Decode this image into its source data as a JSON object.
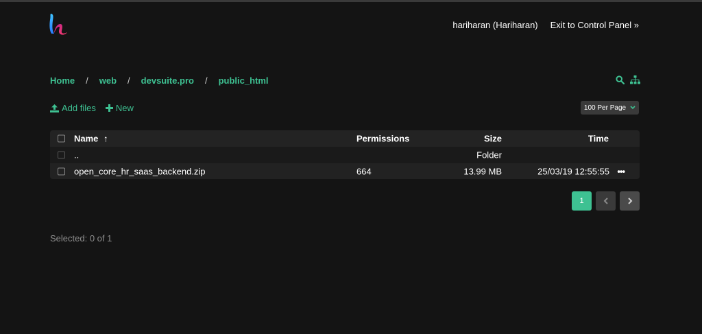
{
  "header": {
    "user_label": "hariharan (Hariharan)",
    "exit_label": "Exit to Control Panel »"
  },
  "breadcrumb": [
    "Home",
    "web",
    "devsuite.pro",
    "public_html"
  ],
  "breadcrumb_separator": "/",
  "toolbar": {
    "add_files_label": "Add files",
    "new_label": "New",
    "per_page_label": "100 Per Page",
    "icons": [
      "search-icon",
      "sitemap-icon",
      "upload-icon",
      "plus-icon",
      "chevron-down-icon"
    ]
  },
  "table": {
    "columns": {
      "name": "Name",
      "permissions": "Permissions",
      "size": "Size",
      "time": "Time"
    },
    "sort_indicator": "↑",
    "up_row": {
      "name": "..",
      "size": "Folder"
    },
    "rows": [
      {
        "name": "open_core_hr_saas_backend.zip",
        "permissions": "664",
        "size": "13.99 MB",
        "time": "25/03/19 12:55:55",
        "menu": "•••"
      }
    ]
  },
  "pagination": {
    "current": "1"
  },
  "status": {
    "selected_text": "Selected: 0 of 1"
  },
  "colors": {
    "accent": "#3ec192",
    "background": "#141414",
    "table": "#1f1f1f"
  }
}
